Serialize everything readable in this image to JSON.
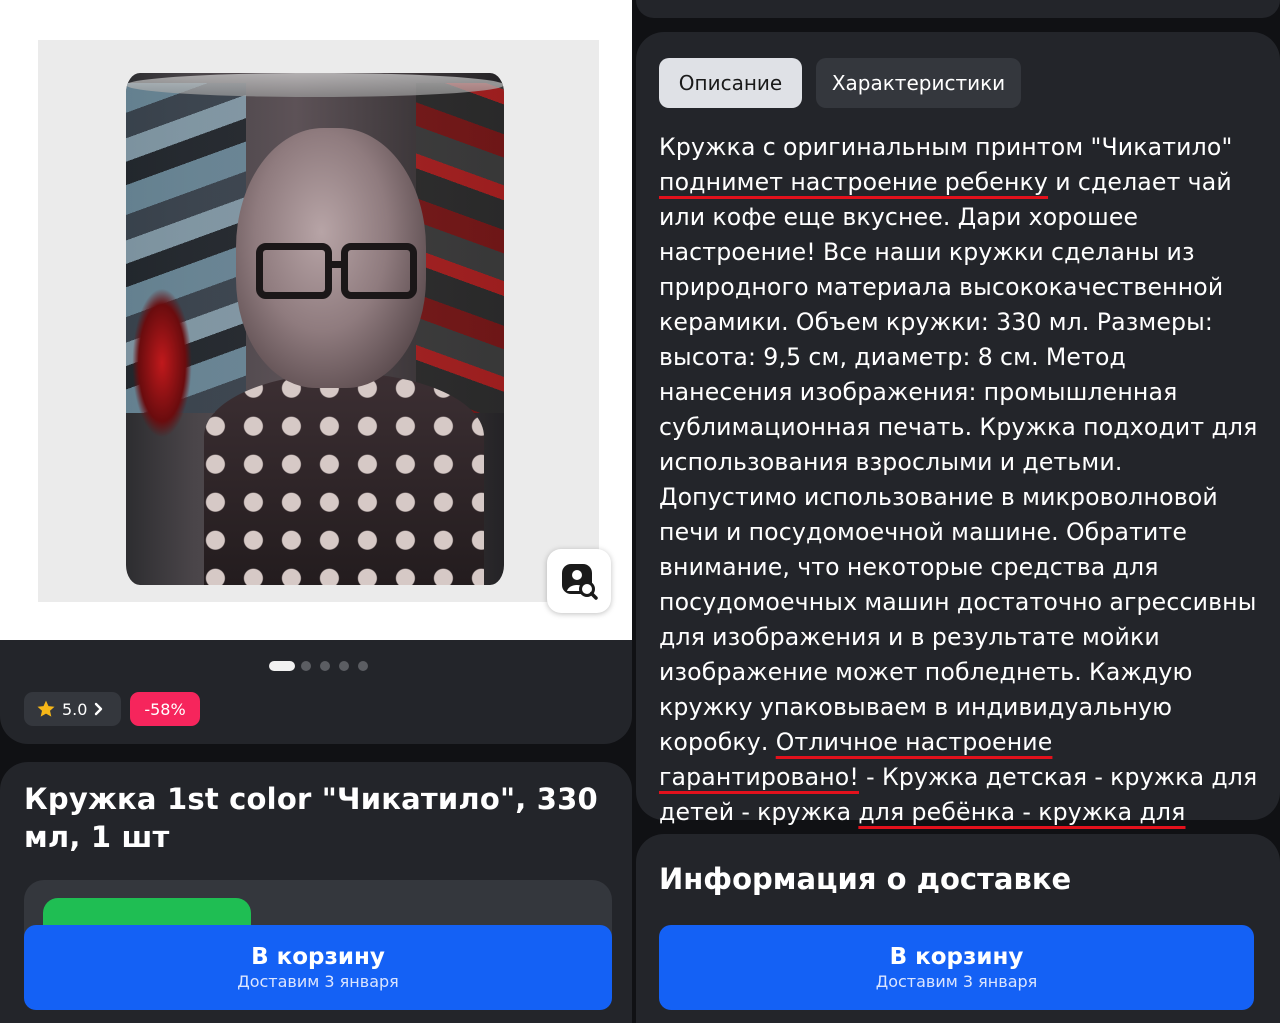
{
  "product": {
    "title": "Кружка 1st color \"Чикатило\", 330 мл, 1 шт",
    "image_alt": "photo-of-mug",
    "gallery": {
      "total": 5,
      "active": 1
    },
    "rating": "5.0",
    "discount": "-58%"
  },
  "tabs": [
    {
      "label": "Описание",
      "active": true
    },
    {
      "label": "Характеристики",
      "active": false
    }
  ],
  "description": {
    "p1": "Кружка с оригинальным принтом \"Чикатило\" ",
    "p1_u": "поднимет настроение ребенку",
    "p2": " и сделает чай или кофе еще вкуснее. Дари хорошее настроение! Все наши кружки сделаны из природного материала высококачественной керамики. Объем кружки: 330 мл. Размеры: высота: 9,5 см, диаметр: 8 см. Метод нанесения изображения: промышленная сублимационная печать. Кружка подходит для использования взрослыми и детьми. Допустимо использование в микроволновой печи и посудомоечной машине. Обратите внимание, что некоторые средства для посудомоечных машин достаточно агрессивны для изображения и в результате мойки изображение может побледнеть. Каждую кружку упаковываем в индивидуальную коробку. ",
    "p2_u": "Отличное настроение гарантировано!",
    "p3": " - Кружка детская - кружка для детей - кружка ",
    "p3_u": "для ребёнка - кружка для Чикатило"
  },
  "delivery": {
    "title": "Информация о доставке"
  },
  "cart_button": {
    "label": "В корзину",
    "sub": "Доставим 3 января"
  },
  "colors": {
    "accent": "#1461f5",
    "discount": "#f6255c",
    "card": "#23252a",
    "bg": "#101114",
    "underline": "#e3111c",
    "badge_green": "#1fbe53"
  },
  "icons": [
    "image-search-icon",
    "star-icon",
    "chevron-right-icon"
  ]
}
